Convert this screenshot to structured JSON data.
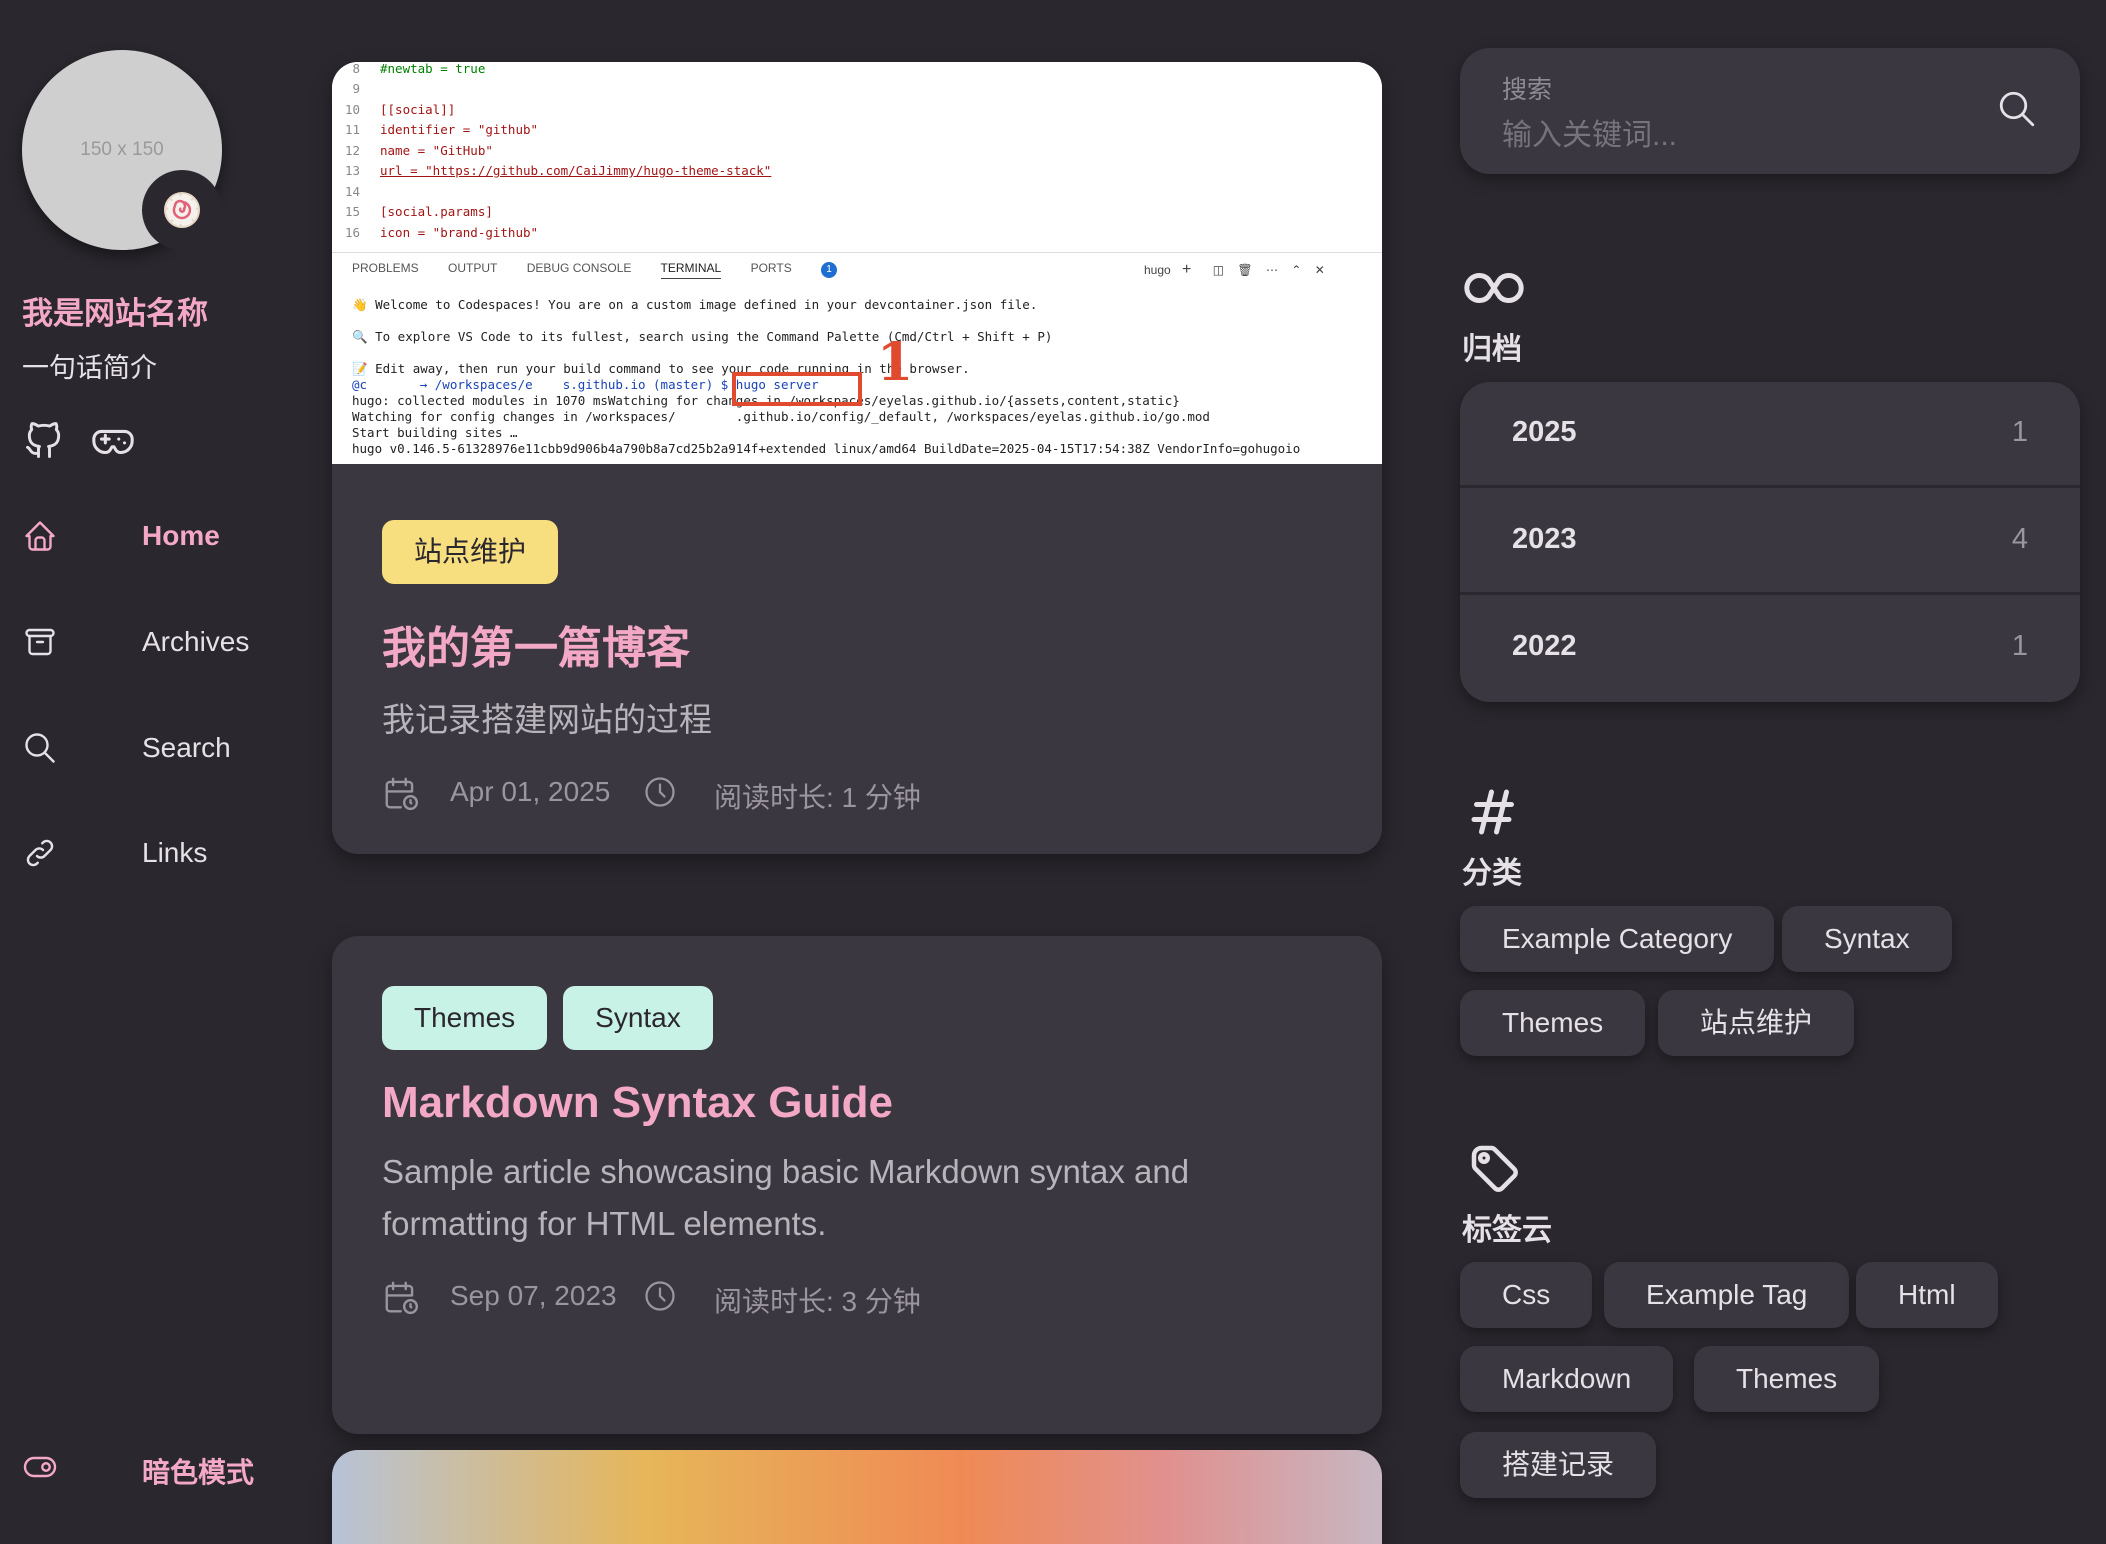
{
  "sidebar": {
    "avatar_text": "150 x 150",
    "avatar_emoji": "🍥",
    "site_name": "我是网站名称",
    "site_desc": "一句话简介",
    "social": [
      "github-icon",
      "gamepad-icon"
    ],
    "nav": [
      {
        "label": "Home",
        "icon": "home-icon",
        "active": true
      },
      {
        "label": "Archives",
        "icon": "archive-box-icon"
      },
      {
        "label": "Search",
        "icon": "search-icon"
      },
      {
        "label": "Links",
        "icon": "link-icon"
      }
    ],
    "dark_mode_label": "暗色模式"
  },
  "screenshot": {
    "code_lines": [
      {
        "n": "8",
        "t": "#newtab = true"
      },
      {
        "n": "9",
        "t": ""
      },
      {
        "n": "10",
        "t": "[[social]]"
      },
      {
        "n": "11",
        "t": "identifier = \"github\""
      },
      {
        "n": "12",
        "t": "name = \"GitHub\""
      },
      {
        "n": "13",
        "t": "url = \"https://github.com/CaiJimmy/hugo-theme-stack\""
      },
      {
        "n": "14",
        "t": ""
      },
      {
        "n": "15",
        "t": "[social.params]"
      },
      {
        "n": "16",
        "t": "icon = \"brand-github\""
      }
    ],
    "tabs": [
      "PROBLEMS",
      "OUTPUT",
      "DEBUG CONSOLE",
      "TERMINAL",
      "PORTS"
    ],
    "ports_badge": "1",
    "terminal_label": "hugo",
    "terminal_lines": [
      "👋 Welcome to Codespaces! You are on a custom image defined in your devcontainer.json file.",
      "🔍 To explore VS Code to its fullest, search using the Command Palette (Cmd/Ctrl + Shift + P)",
      "📝 Edit away, then run your build command to see your code running in the browser.",
      "@c       → /workspaces/e    s.github.io (master) $ hugo server",
      "hugo: collected modules in 1070 msWatching for changes in /workspaces/eyelas.github.io/{assets,content,static}",
      "Watching for config changes in /workspaces/        .github.io/config/_default, /workspaces/eyelas.github.io/go.mod",
      "Start building sites …",
      "hugo v0.146.5-61328976e11cbb9d906b4a790b8a7cd25b2a914f+extended linux/amd64 BuildDate=2025-04-15T17:54:38Z VendorInfo=gohugoio"
    ],
    "annotation_number": "1"
  },
  "posts": [
    {
      "tags": [
        "站点维护"
      ],
      "title": "我的第一篇博客",
      "subtitle": "我记录搭建网站的过程",
      "date": "Apr 01, 2025",
      "reading": "阅读时长: 1 分钟"
    },
    {
      "tags": [
        "Themes",
        "Syntax"
      ],
      "title": "Markdown Syntax Guide",
      "subtitle": "Sample article showcasing basic Markdown syntax and formatting for HTML elements.",
      "date": "Sep 07, 2023",
      "reading": "阅读时长: 3 分钟"
    }
  ],
  "search": {
    "label": "搜索",
    "placeholder": "输入关键词..."
  },
  "archives": {
    "title": "归档",
    "years": [
      {
        "year": "2025",
        "count": "1"
      },
      {
        "year": "2023",
        "count": "4"
      },
      {
        "year": "2022",
        "count": "1"
      }
    ]
  },
  "categories": {
    "title": "分类",
    "items": [
      "Example Category",
      "Syntax",
      "Themes",
      "站点维护"
    ]
  },
  "tag_cloud": {
    "title": "标签云",
    "items": [
      "Css",
      "Example Tag",
      "Html",
      "Markdown",
      "Themes",
      "搭建记录"
    ]
  },
  "colors": {
    "background": "#2a272e",
    "card": "#3a3740",
    "accent": "#f3a8c6",
    "tag_yellow": "#f7de7e",
    "tag_mint": "#c9f2e6"
  }
}
